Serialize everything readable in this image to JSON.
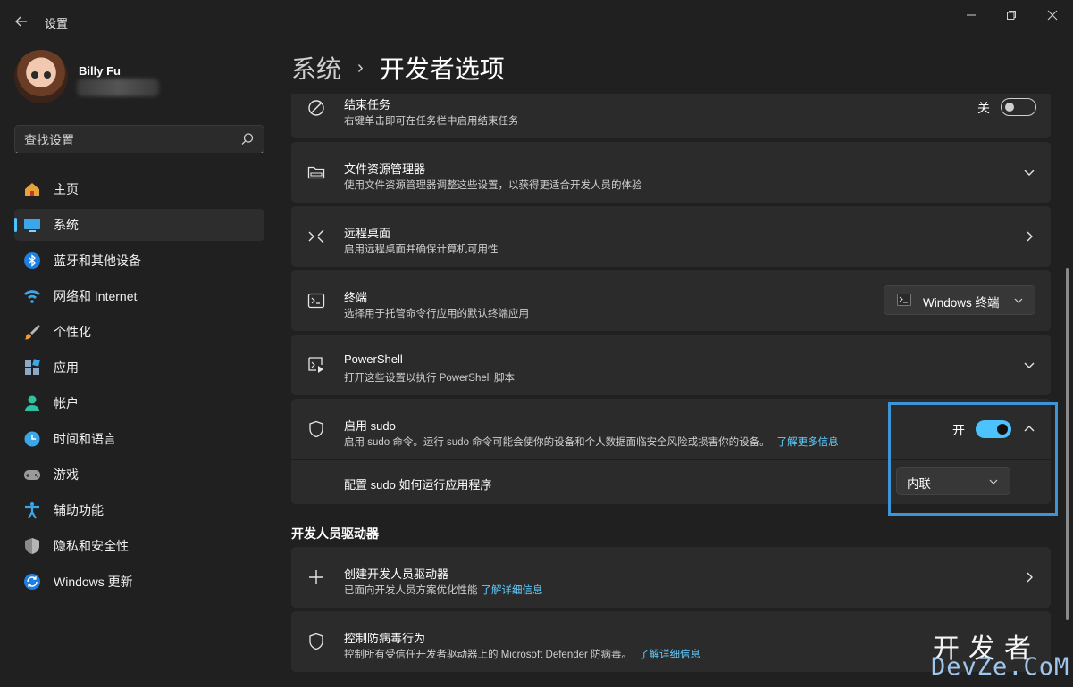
{
  "window": {
    "title": "设置",
    "controls": [
      "minimize",
      "maximize",
      "close"
    ]
  },
  "user": {
    "name": "Billy Fu"
  },
  "search": {
    "placeholder": "查找设置"
  },
  "sidebar": {
    "items": [
      {
        "label": "主页",
        "icon": "home-icon",
        "active": false
      },
      {
        "label": "系统",
        "icon": "system-icon",
        "active": true
      },
      {
        "label": "蓝牙和其他设备",
        "icon": "bluetooth-icon",
        "active": false
      },
      {
        "label": "网络和 Internet",
        "icon": "wifi-icon",
        "active": false
      },
      {
        "label": "个性化",
        "icon": "brush-icon",
        "active": false
      },
      {
        "label": "应用",
        "icon": "apps-icon",
        "active": false
      },
      {
        "label": "帐户",
        "icon": "account-icon",
        "active": false
      },
      {
        "label": "时间和语言",
        "icon": "time-language-icon",
        "active": false
      },
      {
        "label": "游戏",
        "icon": "gaming-icon",
        "active": false
      },
      {
        "label": "辅助功能",
        "icon": "accessibility-icon",
        "active": false
      },
      {
        "label": "隐私和安全性",
        "icon": "shield-icon",
        "active": false
      },
      {
        "label": "Windows 更新",
        "icon": "update-icon",
        "active": false
      }
    ]
  },
  "breadcrumb": {
    "parent": "系统",
    "separator": "›",
    "current": "开发者选项"
  },
  "cards": {
    "end_task": {
      "title": "结束任务",
      "desc": "右键单击即可在任务栏中启用结束任务",
      "toggle_label": "关",
      "toggle_on": false
    },
    "file_explorer": {
      "title": "文件资源管理器",
      "desc": "使用文件资源管理器调整这些设置，以获得更适合开发人员的体验"
    },
    "remote_desktop": {
      "title": "远程桌面",
      "desc": "启用远程桌面并确保计算机可用性"
    },
    "terminal": {
      "title": "终端",
      "desc": "选择用于托管命令行应用的默认终端应用",
      "dropdown_value": "Windows 终端"
    },
    "powershell": {
      "title": "PowerShell",
      "desc": "打开这些设置以执行 PowerShell 脚本"
    },
    "sudo": {
      "title": "启用 sudo",
      "desc": "启用 sudo 命令。运行 sudo 命令可能会使你的设备和个人数据面临安全风险或损害你的设备。",
      "link": "了解更多信息",
      "toggle_label": "开",
      "toggle_on": true,
      "sub_label": "配置 sudo 如何运行应用程序",
      "sub_dropdown_value": "内联"
    }
  },
  "dev_drive": {
    "section_title": "开发人员驱动器",
    "create": {
      "title": "创建开发人员驱动器",
      "desc": "已面向开发人员方案优化性能",
      "link": "了解详细信息"
    },
    "antivirus": {
      "title": "控制防病毒行为",
      "desc": "控制所有受信任开发者驱动器上的 Microsoft Defender 防病毒。",
      "link": "了解详细信息"
    }
  },
  "watermark": {
    "top": "开发者",
    "bottom": "DevZe.CoM"
  },
  "colors": {
    "background": "#202020",
    "card": "#2b2b2b",
    "accent": "#4cc2ff",
    "link": "#60cdff",
    "highlight_border": "#3c95d6"
  }
}
